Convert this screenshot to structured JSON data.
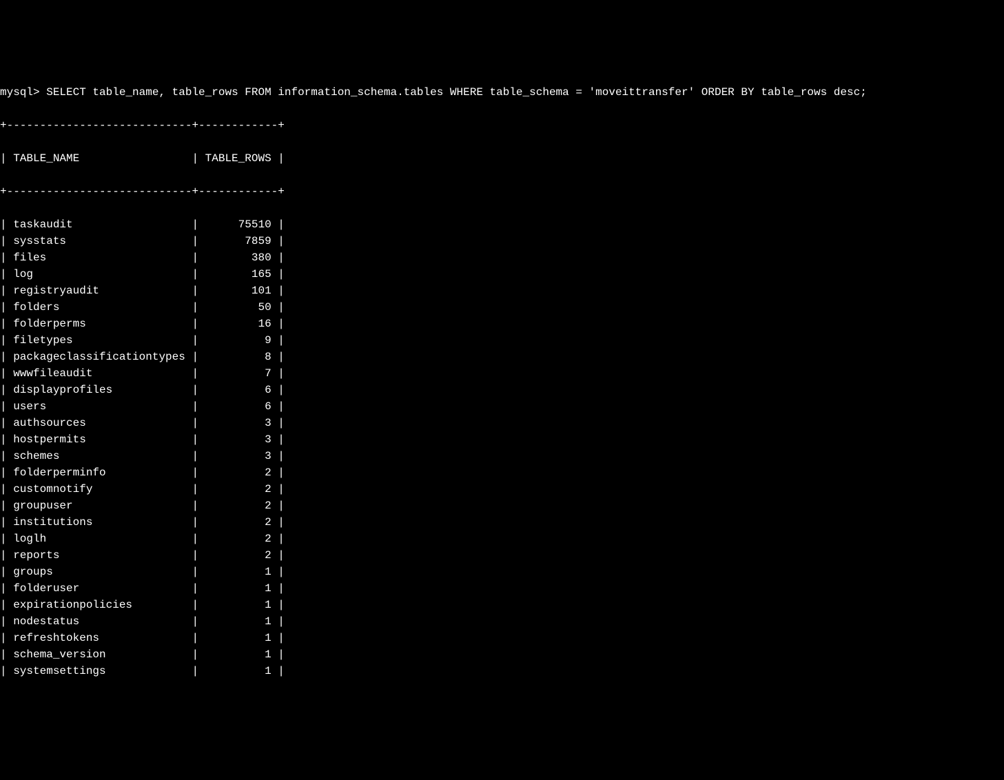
{
  "prompt": "mysql> ",
  "query": "SELECT table_name, table_rows FROM information_schema.tables WHERE table_schema = 'moveittransfer' ORDER BY table_rows desc;",
  "columns": {
    "name": "TABLE_NAME",
    "rows": "TABLE_ROWS"
  },
  "col_widths": {
    "name": 28,
    "rows": 12
  },
  "chart_data": {
    "type": "table",
    "title": "MySQL information_schema.tables for moveittransfer",
    "columns": [
      "TABLE_NAME",
      "TABLE_ROWS"
    ],
    "rows": [
      {
        "name": "taskaudit",
        "rows": 75510
      },
      {
        "name": "sysstats",
        "rows": 7859
      },
      {
        "name": "files",
        "rows": 380
      },
      {
        "name": "log",
        "rows": 165
      },
      {
        "name": "registryaudit",
        "rows": 101
      },
      {
        "name": "folders",
        "rows": 50
      },
      {
        "name": "folderperms",
        "rows": 16
      },
      {
        "name": "filetypes",
        "rows": 9
      },
      {
        "name": "packageclassificationtypes",
        "rows": 8
      },
      {
        "name": "wwwfileaudit",
        "rows": 7
      },
      {
        "name": "displayprofiles",
        "rows": 6
      },
      {
        "name": "users",
        "rows": 6
      },
      {
        "name": "authsources",
        "rows": 3
      },
      {
        "name": "hostpermits",
        "rows": 3
      },
      {
        "name": "schemes",
        "rows": 3
      },
      {
        "name": "folderperminfo",
        "rows": 2
      },
      {
        "name": "customnotify",
        "rows": 2
      },
      {
        "name": "groupuser",
        "rows": 2
      },
      {
        "name": "institutions",
        "rows": 2
      },
      {
        "name": "loglh",
        "rows": 2
      },
      {
        "name": "reports",
        "rows": 2
      },
      {
        "name": "groups",
        "rows": 1
      },
      {
        "name": "folderuser",
        "rows": 1
      },
      {
        "name": "expirationpolicies",
        "rows": 1
      },
      {
        "name": "nodestatus",
        "rows": 1
      },
      {
        "name": "refreshtokens",
        "rows": 1
      },
      {
        "name": "schema_version",
        "rows": 1
      },
      {
        "name": "systemsettings",
        "rows": 1
      }
    ]
  }
}
